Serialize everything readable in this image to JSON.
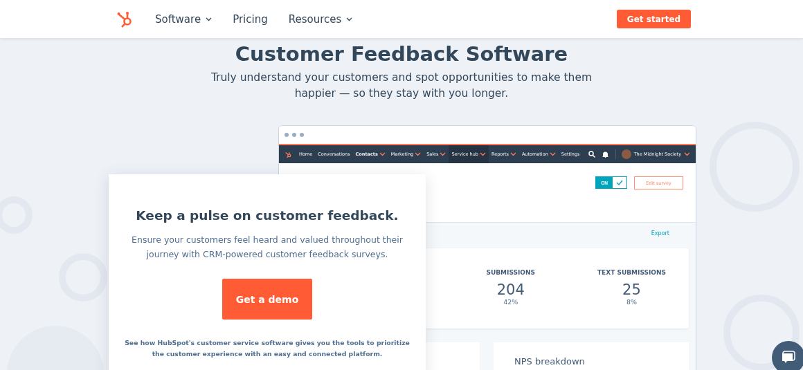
{
  "header": {
    "menu": [
      {
        "label": "Software",
        "caret": true
      },
      {
        "label": "Pricing",
        "caret": false
      },
      {
        "label": "Resources",
        "caret": true
      }
    ],
    "cta": "Get started"
  },
  "hero": {
    "title": "Customer Feedback Software",
    "subtitle": "Truly understand your customers and spot opportunities to make them happier — so they stay with you longer."
  },
  "app_window": {
    "nav": [
      {
        "label": "Home",
        "caret": false,
        "bold": false,
        "selected": false
      },
      {
        "label": "Conversations",
        "caret": false,
        "bold": false,
        "selected": false
      },
      {
        "label": "Contacts",
        "caret": true,
        "bold": true,
        "selected": false
      },
      {
        "label": "Marketing",
        "caret": true,
        "bold": false,
        "selected": false
      },
      {
        "label": "Sales",
        "caret": true,
        "bold": false,
        "selected": false
      },
      {
        "label": "Service hub",
        "caret": true,
        "bold": false,
        "selected": true
      },
      {
        "label": "Reports",
        "caret": true,
        "bold": false,
        "selected": false
      },
      {
        "label": "Automation",
        "caret": true,
        "bold": false,
        "selected": false
      },
      {
        "label": "Settings",
        "caret": false,
        "bold": false,
        "selected": false
      }
    ],
    "account": "The Midnight Society",
    "toggle": {
      "label": "ON",
      "on": true
    },
    "edit_button": "Edit survey",
    "export": "Export",
    "stats": [
      {
        "label": "SUBMISSIONS",
        "value": "204",
        "percent": "42%"
      },
      {
        "label": "TEXT SUBMISSIONS",
        "value": "25",
        "percent": "8%"
      }
    ],
    "nps_title": "NPS breakdown"
  },
  "promo_card": {
    "title": "Keep a pulse on customer feedback.",
    "body": "Ensure your customers feel heard and valued throughout their journey with CRM-powered customer feedback surveys.",
    "button": "Get a demo",
    "footnote": "See how HubSpot's customer service software gives you the tools to prioritize the customer experience with an easy and connected platform."
  }
}
